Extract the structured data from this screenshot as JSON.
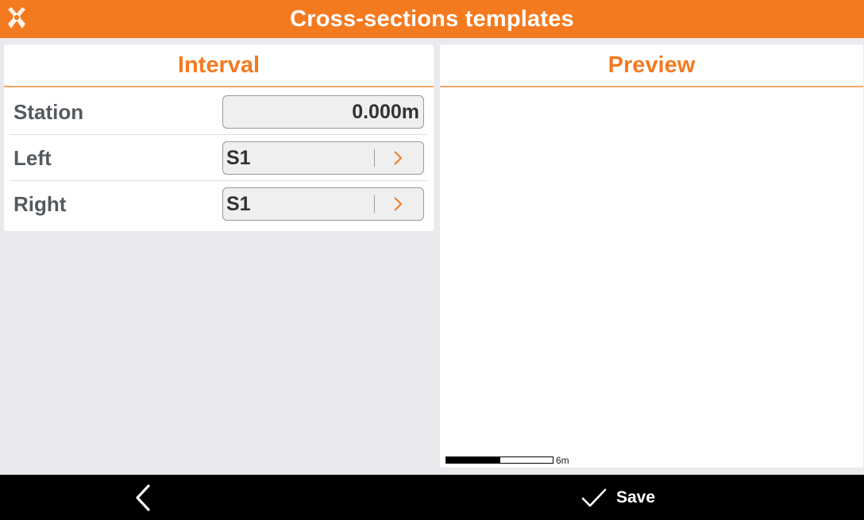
{
  "header": {
    "title": "Cross-sections templates",
    "logo_icon": "app-logo-icon"
  },
  "interval_panel": {
    "title": "Interval",
    "rows": [
      {
        "label": "Station",
        "value": "0.000m",
        "type": "number"
      },
      {
        "label": "Left",
        "value": "S1",
        "type": "select",
        "icon": "chevron-right-icon"
      },
      {
        "label": "Right",
        "value": "S1",
        "type": "select",
        "icon": "chevron-right-icon"
      }
    ]
  },
  "preview_panel": {
    "title": "Preview",
    "scale_label": "6m"
  },
  "footer": {
    "back_icon": "chevron-left-icon",
    "save_icon": "check-icon",
    "save_label": "Save"
  },
  "colors": {
    "accent": "#f47a20",
    "accent_light": "#f6a564",
    "background": "#e9eaed",
    "footer": "#000000"
  }
}
